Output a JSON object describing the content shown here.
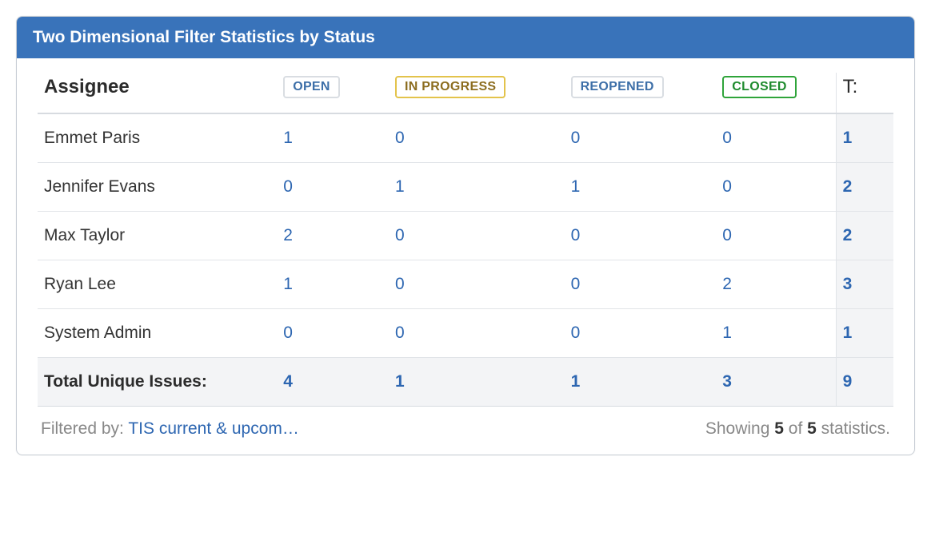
{
  "header": {
    "title": "Two Dimensional Filter Statistics by Status"
  },
  "table": {
    "assignee_header": "Assignee",
    "total_header": "T:",
    "status_columns": [
      {
        "label": "OPEN",
        "style": "open"
      },
      {
        "label": "IN PROGRESS",
        "style": "progress"
      },
      {
        "label": "REOPENED",
        "style": "reopened"
      },
      {
        "label": "CLOSED",
        "style": "closed"
      }
    ],
    "rows": [
      {
        "name": "Emmet Paris",
        "values": [
          "1",
          "0",
          "0",
          "0"
        ],
        "total": "1"
      },
      {
        "name": "Jennifer Evans",
        "values": [
          "0",
          "1",
          "1",
          "0"
        ],
        "total": "2"
      },
      {
        "name": "Max Taylor",
        "values": [
          "2",
          "0",
          "0",
          "0"
        ],
        "total": "2"
      },
      {
        "name": "Ryan Lee",
        "values": [
          "1",
          "0",
          "0",
          "2"
        ],
        "total": "3"
      },
      {
        "name": "System Admin",
        "values": [
          "0",
          "0",
          "0",
          "1"
        ],
        "total": "1"
      }
    ],
    "totals": {
      "label": "Total Unique Issues:",
      "values": [
        "4",
        "1",
        "1",
        "3"
      ],
      "total": "9"
    }
  },
  "footer": {
    "filtered_by_label": "Filtered by: ",
    "filter_name": "TIS current & upcom…",
    "showing_prefix": "Showing ",
    "showing_count": "5",
    "showing_of": " of ",
    "showing_total": "5",
    "showing_suffix": " statistics."
  }
}
